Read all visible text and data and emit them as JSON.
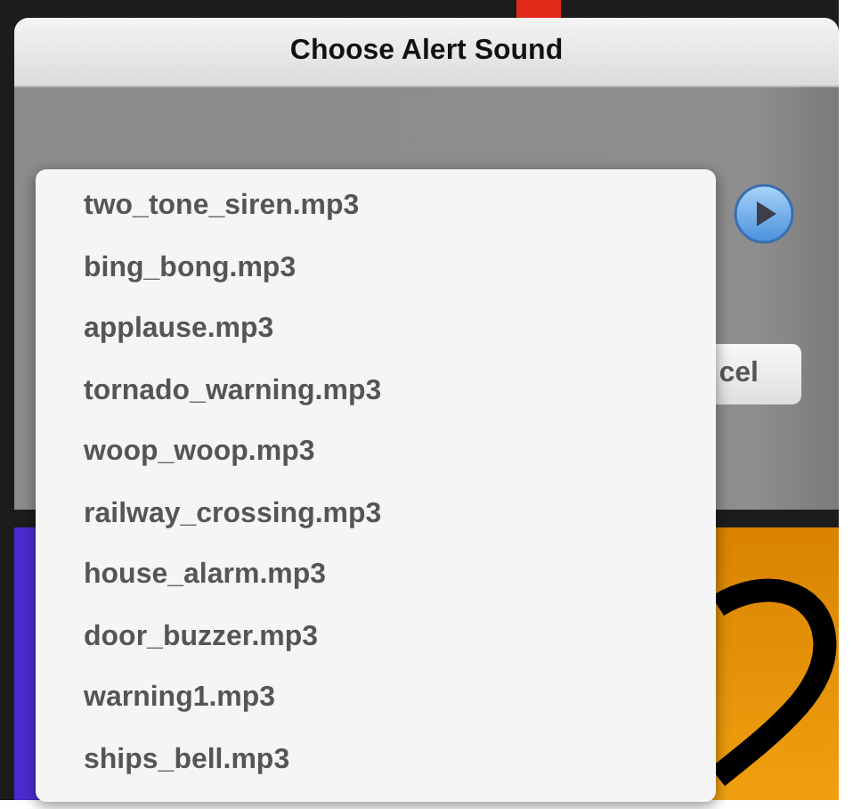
{
  "dialog": {
    "title": "Choose Alert Sound",
    "cancel_button": "cel"
  },
  "sound_list": [
    "two_tone_siren.mp3",
    "bing_bong.mp3",
    "applause.mp3",
    "tornado_warning.mp3",
    "woop_woop.mp3",
    "railway_crossing.mp3",
    "house_alarm.mp3",
    "door_buzzer.mp3",
    "warning1.mp3",
    "ships_bell.mp3"
  ]
}
